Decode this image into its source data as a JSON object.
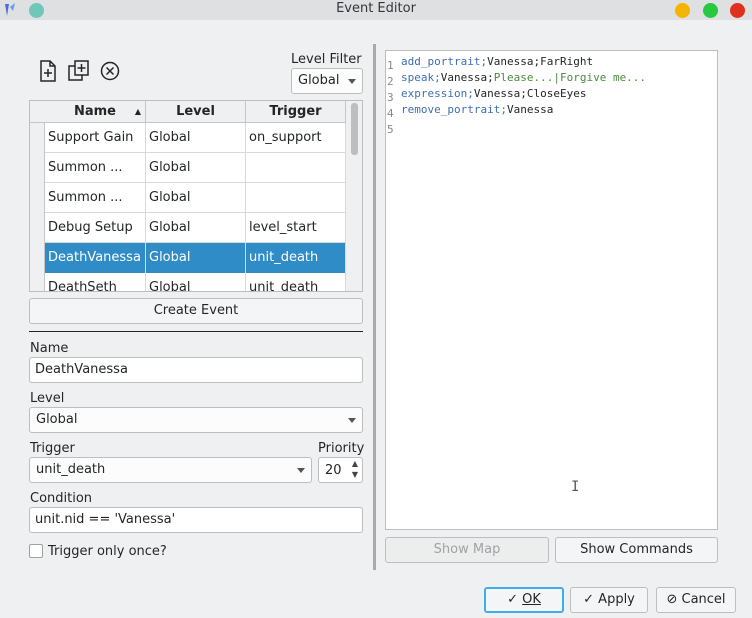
{
  "window": {
    "title": "Event Editor",
    "buttons": {
      "minimize_color": "#f5b400",
      "maximize_color": "#27c93f",
      "close_color": "#e0301e"
    },
    "menu_dot_color": "#6ec7b8"
  },
  "toolbar": {
    "icons": [
      "new-file-icon",
      "duplicate-icon",
      "delete-icon"
    ]
  },
  "level_filter": {
    "label": "Level Filter",
    "value": "Global"
  },
  "table": {
    "columns": [
      "Name",
      "Level",
      "Trigger"
    ],
    "rows": [
      {
        "name": "Support Gain",
        "level": "Global",
        "trigger": "on_support"
      },
      {
        "name": "Summon ...",
        "level": "Global",
        "trigger": ""
      },
      {
        "name": "Summon ...",
        "level": "Global",
        "trigger": ""
      },
      {
        "name": "Debug Setup",
        "level": "Global",
        "trigger": "level_start"
      },
      {
        "name": "DeathVanessa",
        "level": "Global",
        "trigger": "unit_death"
      },
      {
        "name": "DeathSeth",
        "level": "Global",
        "trigger": "unit_death"
      }
    ],
    "selected_index": 4,
    "selected_color": "#308cc6"
  },
  "create_event_label": "Create Event",
  "form": {
    "name_label": "Name",
    "name_value": "DeathVanessa",
    "level_label": "Level",
    "level_value": "Global",
    "trigger_label": "Trigger",
    "trigger_value": "unit_death",
    "priority_label": "Priority",
    "priority_value": "20",
    "condition_label": "Condition",
    "condition_value": "unit.nid == 'Vanessa'",
    "trigger_once_label": "Trigger only once?"
  },
  "editor": {
    "line_numbers": [
      "1",
      "2",
      "3",
      "4",
      "5"
    ],
    "lines": [
      {
        "cmd": "add_portrait",
        "sep": ";",
        "args": "Vanessa;FarRight",
        "str": ""
      },
      {
        "cmd": "speak",
        "sep": ";",
        "args": "Vanessa;",
        "str": "Please...|Forgive me..."
      },
      {
        "cmd": "expression",
        "sep": ";",
        "args": "Vanessa;CloseEyes",
        "str": ""
      },
      {
        "cmd": "remove_portrait",
        "sep": ";",
        "args": "Vanessa",
        "str": ""
      },
      {
        "cmd": "",
        "sep": "",
        "args": "",
        "str": ""
      }
    ]
  },
  "buttons": {
    "show_map": "Show Map",
    "show_commands": "Show Commands",
    "ok": "OK",
    "apply": "Apply",
    "cancel": "Cancel"
  }
}
